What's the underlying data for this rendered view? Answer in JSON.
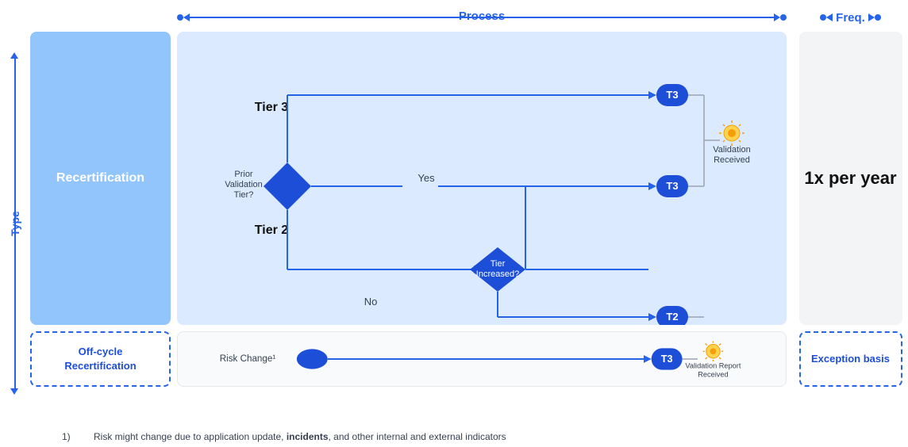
{
  "header": {
    "process_label": "Process",
    "freq_label": "Freq.",
    "type_label": "Type"
  },
  "left_column": {
    "recertification_label": "Recertification",
    "off_cycle_label": "Off-cycle\nRecertification"
  },
  "freq_column": {
    "value": "1x per year"
  },
  "exception": {
    "label": "Exception basis"
  },
  "diagram": {
    "tier3_label": "Tier 3",
    "tier2_label": "Tier 2",
    "prior_validation_label": "Prior\nValidation\nTier?",
    "yes_label": "Yes",
    "no_label": "No",
    "tier_increased_label": "Tier\nIncreased?",
    "t3_label": "T3",
    "t2_label": "T2",
    "validation_received_label": "Validation\nReceived",
    "validation_report_received_label": "Validation Report\nReceived",
    "risk_change_label": "Risk Change¹"
  },
  "footnote": {
    "number": "1)",
    "text": "Risk might change due to application update, ",
    "bold_text": "incidents",
    "text2": ", and other internal and external indicators"
  }
}
